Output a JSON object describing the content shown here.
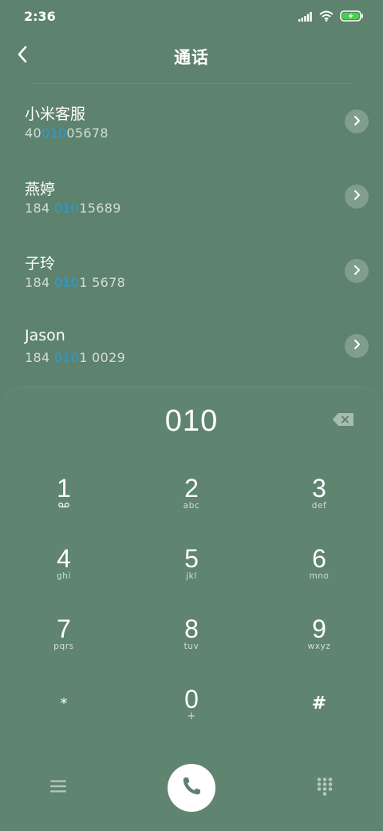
{
  "status_bar": {
    "time": "2:36",
    "icons": [
      "signal-icon",
      "wifi-icon",
      "battery-charging-icon"
    ]
  },
  "header": {
    "title": "通话",
    "back_icon": "back-arrow-icon"
  },
  "contacts": [
    {
      "name": "小米客服",
      "number_pre": "40",
      "number_match": "010",
      "number_post": "05678"
    },
    {
      "name": "燕婷",
      "number_pre": "184 ",
      "number_match": "010",
      "number_post": "15689"
    },
    {
      "name": "子玲",
      "number_pre": "184 ",
      "number_match": "010",
      "number_post": "1 5678"
    },
    {
      "name": "Jason",
      "number_pre": "184 ",
      "number_match": "010",
      "number_post": "1 0029"
    }
  ],
  "dialer": {
    "input": "010",
    "backspace_icon": "backspace-icon"
  },
  "keys": [
    {
      "digit": "1",
      "letters": ""
    },
    {
      "digit": "2",
      "letters": "abc"
    },
    {
      "digit": "3",
      "letters": "def"
    },
    {
      "digit": "4",
      "letters": "ghi"
    },
    {
      "digit": "5",
      "letters": "jkl"
    },
    {
      "digit": "6",
      "letters": "mno"
    },
    {
      "digit": "7",
      "letters": "pqrs"
    },
    {
      "digit": "8",
      "letters": "tuv"
    },
    {
      "digit": "9",
      "letters": "wxyz"
    },
    {
      "digit": "*",
      "letters": ""
    },
    {
      "digit": "0",
      "letters": "+"
    },
    {
      "digit": "#",
      "letters": ""
    }
  ],
  "bottom_bar": {
    "menu_icon": "menu-icon",
    "call_icon": "phone-icon",
    "keypad_icon": "dialpad-icon"
  },
  "colors": {
    "background": "#5d826e",
    "highlight": "#2c9bd3",
    "call_button": "#ffffff"
  }
}
